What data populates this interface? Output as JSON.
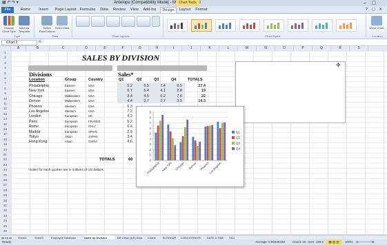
{
  "window": {
    "title": "Antelope [Compatibility Mode] - Microsoft Excel",
    "context_tab": "Chart Tools",
    "controls": "– ▢ ✕",
    "quick_access": "▦ ↶ ↷ ▾"
  },
  "ribbon_tabs": [
    "File",
    "Home",
    "Insert",
    "Page Layout",
    "Formulas",
    "Data",
    "Review",
    "View",
    "Add-Ins",
    "Design",
    "Layout",
    "Format"
  ],
  "ribbon": {
    "buttons": [
      {
        "label": "Change Chart Type",
        "icon": "change-chart-type-icon"
      },
      {
        "label": "Save As Template",
        "icon": "save-template-icon"
      },
      {
        "label": "Switch Row/Column",
        "icon": "switch-row-column-icon"
      },
      {
        "label": "Select Data",
        "icon": "select-data-icon"
      }
    ],
    "groups": [
      "Type",
      "Data",
      "Chart Layouts",
      "Chart Styles",
      "Location"
    ],
    "move_chart_label": "Move Chart"
  },
  "formula_bar": {
    "name_box": "Chart 2",
    "fx": "fx"
  },
  "columns": [
    "A",
    "B",
    "C",
    "D",
    "E",
    "F",
    "G",
    "H",
    "I",
    "J",
    "K",
    "L",
    "M",
    "N",
    "O",
    "P",
    "Q",
    "R",
    "S"
  ],
  "sheet": {
    "title": "SALES BY DIVISION",
    "divisions_label": "Divisions",
    "sales_label": "Sales*",
    "headers": {
      "location": "Location",
      "group": "Group",
      "country": "Country",
      "q1": "Q1",
      "q2": "Q2",
      "q3": "Q3",
      "q4": "Q4",
      "totals": "TOTALS"
    },
    "rows": [
      {
        "location": "Philadelphia",
        "group": "Eastern",
        "country": "USA",
        "q1": "5.2",
        "q2": "6.5",
        "q3": "7.4",
        "q4": "8.5",
        "total": "27.4"
      },
      {
        "location": "New York",
        "group": "Eastern",
        "country": "USA",
        "q1": "6.7",
        "q2": "5.4",
        "q3": "4.1",
        "q4": "2.8",
        "total": "19"
      },
      {
        "location": "Chicago",
        "group": "Midwestern",
        "country": "USA",
        "q1": "3.4",
        "q2": "4.5",
        "q3": "6.2",
        "q4": "7.6",
        "total": "22"
      },
      {
        "location": "Denver",
        "group": "Midwestern",
        "country": "USA",
        "q1": "4.4",
        "q2": "3.7",
        "q3": "2.7",
        "q4": "3.5",
        "total": "14.3"
      },
      {
        "location": "Phoenix",
        "group": "Western",
        "country": "USA",
        "q1": "6.3",
        "q2": "",
        "q3": "",
        "q4": "",
        "total": ""
      },
      {
        "location": "Los Angeles",
        "group": "Western",
        "country": "USA",
        "q1": "7.2",
        "q2": "",
        "q3": "",
        "q4": "",
        "total": ""
      },
      {
        "location": "London",
        "group": "European",
        "country": "UK",
        "q1": "4.3",
        "q2": "",
        "q3": "",
        "q4": "",
        "total": ""
      },
      {
        "location": "Paris",
        "group": "European",
        "country": "FRANCE",
        "q1": "5.2",
        "q2": "",
        "q3": "",
        "q4": "",
        "total": ""
      },
      {
        "location": "Rome",
        "group": "European",
        "country": "ITALY",
        "q1": "6.4",
        "q2": "",
        "q3": "",
        "q4": "",
        "total": ""
      },
      {
        "location": "Madrid",
        "group": "European",
        "country": "SPAIN",
        "q1": "2.9",
        "q2": "",
        "q3": "",
        "q4": "",
        "total": ""
      },
      {
        "location": "Tokyo",
        "group": "Asian",
        "country": "JAPAN",
        "q1": "3.4",
        "q2": "",
        "q3": "",
        "q4": "",
        "total": ""
      },
      {
        "location": "Hong Kong",
        "group": "Asian",
        "country": "CHINA",
        "q1": "4.6",
        "q2": "",
        "q3": "",
        "q4": "",
        "total": ""
      }
    ],
    "totals_label": "TOTALS",
    "totals_q1": "60",
    "note": "*Sales for each quarter are in millions of US dollars"
  },
  "chart_data": {
    "type": "bar",
    "categories": [
      "Philadelphia",
      "New York",
      "Chicago",
      "Denver",
      "Phoenix",
      "Los Angeles"
    ],
    "series": [
      {
        "name": "Q1",
        "values": [
          5.2,
          6.7,
          3.4,
          4.4,
          6.3,
          7.2
        ],
        "color": "#4f81bd"
      },
      {
        "name": "Q2",
        "values": [
          6.5,
          5.4,
          4.5,
          3.7,
          6.4,
          6.0
        ],
        "color": "#c0504d"
      },
      {
        "name": "Q3",
        "values": [
          7.4,
          4.1,
          6.2,
          2.7,
          6.5,
          7.0
        ],
        "color": "#9bbb59"
      },
      {
        "name": "Q4",
        "values": [
          8.5,
          2.8,
          7.6,
          3.5,
          6.6,
          7.1
        ],
        "color": "#8064a2"
      }
    ],
    "ylim": [
      0,
      9
    ],
    "yticks": [
      0,
      1,
      2,
      3,
      4,
      5,
      6,
      7,
      8,
      9
    ],
    "legend": "right"
  },
  "sheet_tabs": [
    "Sheet1",
    "Sheet3",
    "Employee Database",
    "Sales by Division",
    "DD Clean (US) Data",
    "Charts",
    "BLOOKUP",
    "CONCATENATE",
    "DATE & TIME",
    "SKU"
  ],
  "active_sheet_tab": "Sales by Division",
  "status": {
    "ready": "Ready",
    "average": "Average: 5.85948438",
    "count": "Count: 25",
    "sum": "Sum: 128.6",
    "zoom": "100%"
  },
  "colors": {
    "file_tab": "#2f6fbf",
    "accent": "#e4a83c",
    "header_bar": "#b7b7b7"
  }
}
